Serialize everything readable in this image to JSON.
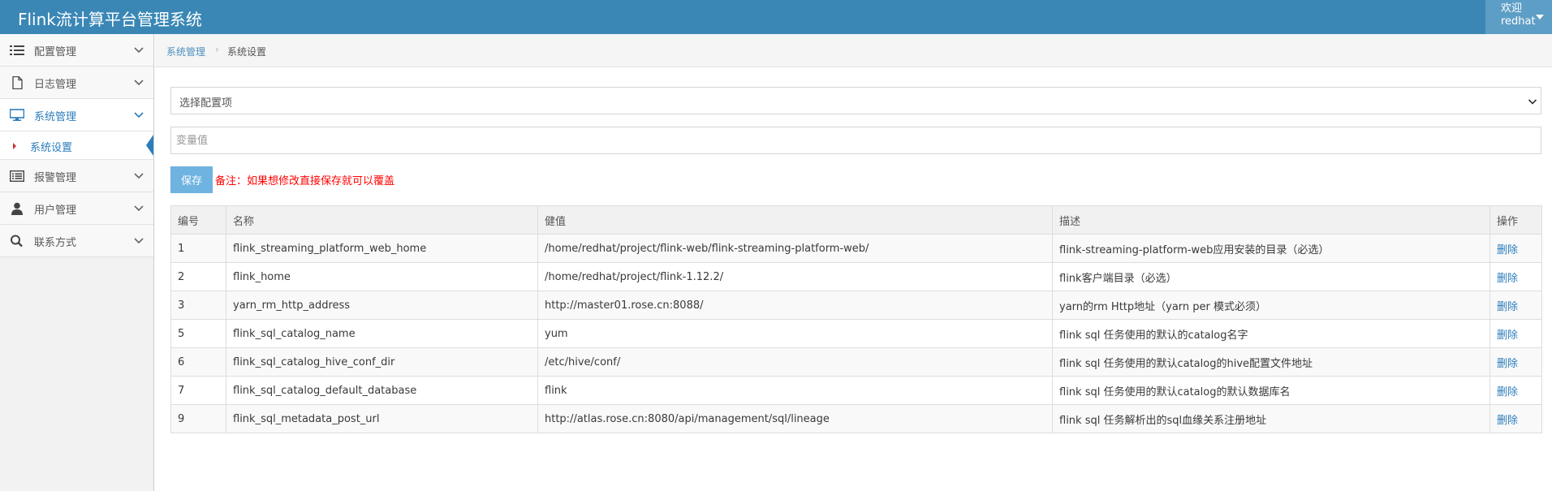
{
  "header": {
    "title": "Flink流计算平台管理系统",
    "welcome": "欢迎",
    "username": "redhat"
  },
  "sidebar": {
    "items": [
      {
        "label": "配置管理",
        "icon": "list-icon"
      },
      {
        "label": "日志管理",
        "icon": "file-icon"
      },
      {
        "label": "系统管理",
        "icon": "desktop-icon",
        "active": true
      },
      {
        "label": "报警管理",
        "icon": "list-alt-icon"
      },
      {
        "label": "用户管理",
        "icon": "user-icon"
      },
      {
        "label": "联系方式",
        "icon": "search-icon"
      }
    ],
    "sub_item": {
      "label": "系统设置"
    }
  },
  "breadcrumb": {
    "parent": "系统管理",
    "current": "系统设置"
  },
  "form": {
    "select_placeholder": "选择配置项",
    "value_placeholder": "变量值",
    "save_label": "保存",
    "note": "备注：如果想修改直接保存就可以覆盖"
  },
  "table": {
    "headers": [
      "编号",
      "名称",
      "健值",
      "描述",
      "操作"
    ],
    "rows": [
      {
        "id": "1",
        "name": "flink_streaming_platform_web_home",
        "value": "/home/redhat/project/flink-web/flink-streaming-platform-web/",
        "desc": "flink-streaming-platform-web应用安装的目录（必选）",
        "action": "删除"
      },
      {
        "id": "2",
        "name": "flink_home",
        "value": "/home/redhat/project/flink-1.12.2/",
        "desc": "flink客户端目录（必选）",
        "action": "删除"
      },
      {
        "id": "3",
        "name": "yarn_rm_http_address",
        "value": "http://master01.rose.cn:8088/",
        "desc": "yarn的rm Http地址（yarn per 模式必须）",
        "action": "删除"
      },
      {
        "id": "5",
        "name": "flink_sql_catalog_name",
        "value": "yum",
        "desc": "flink sql 任务使用的默认的catalog名字",
        "action": "删除"
      },
      {
        "id": "6",
        "name": "flink_sql_catalog_hive_conf_dir",
        "value": "/etc/hive/conf/",
        "desc": "flink sql 任务使用的默认catalog的hive配置文件地址",
        "action": "删除"
      },
      {
        "id": "7",
        "name": "flink_sql_catalog_default_database",
        "value": "flink",
        "desc": "flink sql 任务使用的默认catalog的默认数据库名",
        "action": "删除"
      },
      {
        "id": "9",
        "name": "flink_sql_metadata_post_url",
        "value": "http://atlas.rose.cn:8080/api/management/sql/lineage",
        "desc": "flink sql 任务解析出的sql血缘关系注册地址",
        "action": "删除"
      }
    ]
  },
  "colors": {
    "navbar": "#3a87b6",
    "accent": "#2b7dbc",
    "save_button": "#6fb3e0",
    "note": "#ff0000"
  }
}
